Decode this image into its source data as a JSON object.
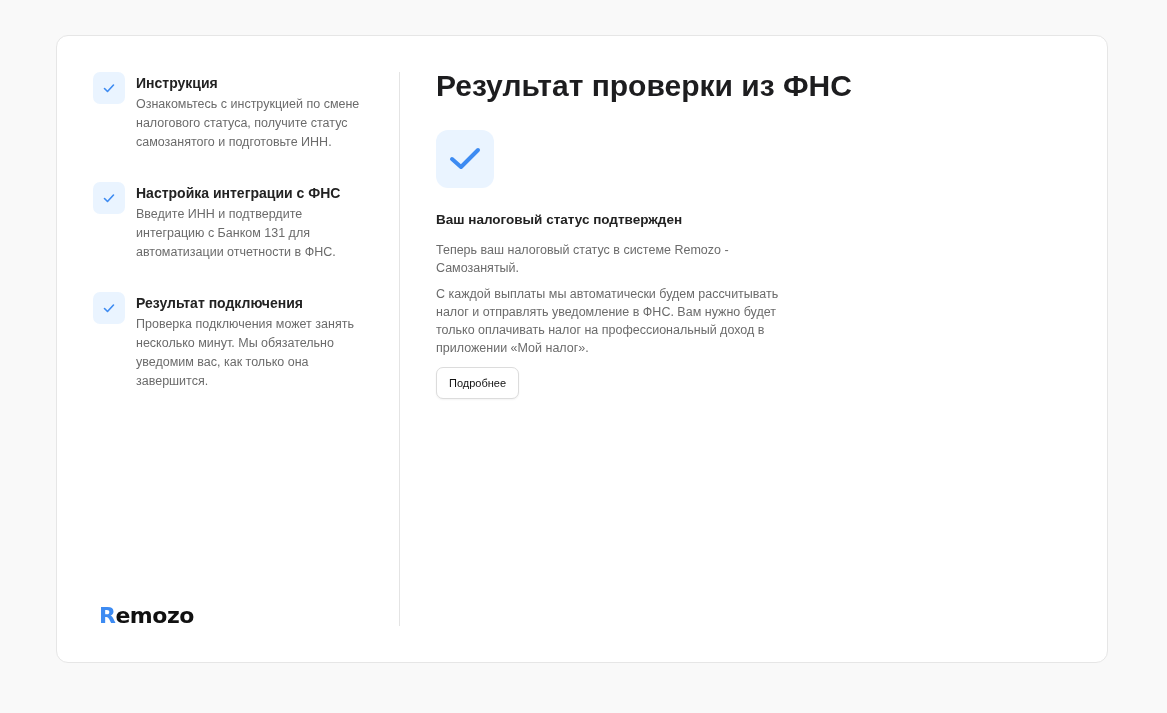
{
  "steps": [
    {
      "title": "Инструкция",
      "description": "Ознакомьтесь с инструкцией по смене налогового статуса, получите статус самозанятого и подготовьте ИНН.",
      "done": true
    },
    {
      "title": "Настройка интеграции с ФНС",
      "description": "Введите ИНН и подтвердите интеграцию с Банком 131 для автоматизации отчетности в ФНС.",
      "done": true
    },
    {
      "title": "Результат подключения",
      "description": "Проверка подключения может занять несколько минут. Мы обязательно уведомим вас, как только она завершится.",
      "done": true
    }
  ],
  "logo": "Remozo",
  "result": {
    "title": "Результат проверки из ФНС",
    "confirmed": true,
    "subtitle": "Ваш налоговый статус подтвержден",
    "paragraphs": [
      "Теперь ваш налоговый статус в системе Remozo - Самозанятый.",
      "С каждой выплаты мы автоматически будем рассчитывать налог и отправлять уведомление в ФНС. Вам нужно будет только оплачивать налог на профессиональный доход в приложении «Мой налог»."
    ],
    "button": "Подробнее"
  }
}
